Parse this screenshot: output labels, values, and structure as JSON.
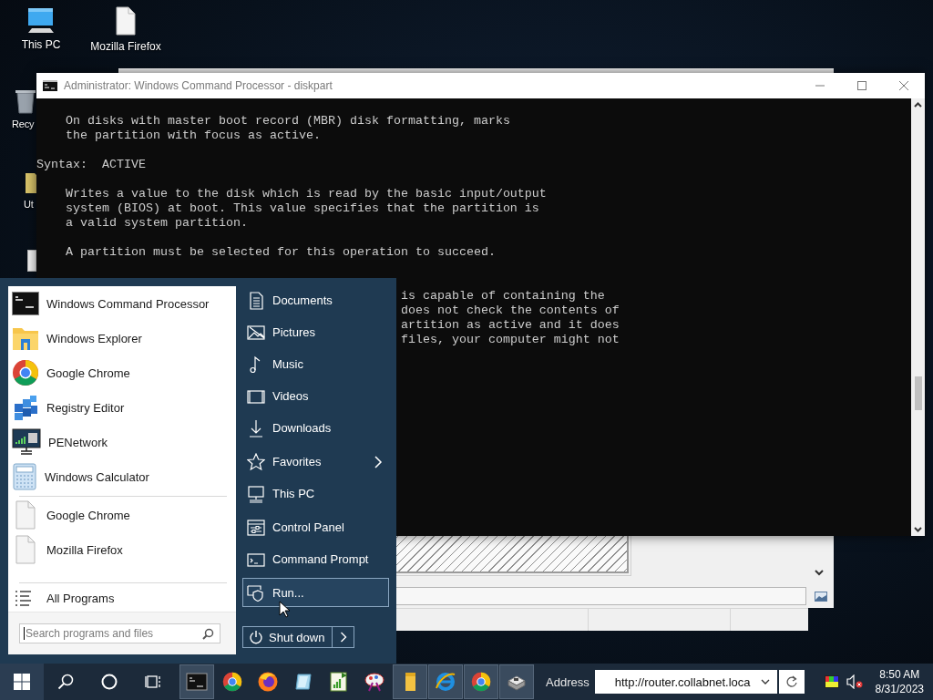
{
  "desktop_icons": [
    {
      "label": "This PC",
      "kind": "full"
    },
    {
      "label": "Mozilla Firefox",
      "kind": "full"
    },
    {
      "label": "Recy",
      "kind": "partial"
    },
    {
      "label": "Ut",
      "kind": "partial"
    }
  ],
  "console_window": {
    "title": "Administrator: Windows Command Processor - diskpart",
    "blocks": [
      {
        "kind": "indented",
        "lines": [
          "On disks with master boot record (MBR) disk formatting, marks",
          "the partition with focus as active."
        ]
      },
      {
        "kind": "flush",
        "lines": [
          "Syntax:  ACTIVE"
        ]
      },
      {
        "kind": "indented",
        "lines": [
          "Writes a value to the disk which is read by the basic input/output",
          "system (BIOS) at boot. This value specifies that the partition is",
          "a valid system partition."
        ]
      },
      {
        "kind": "indented",
        "lines": [
          "A partition must be selected for this operation to succeed."
        ]
      },
      {
        "kind": "covered",
        "lines": [
          "is capable of containing the",
          "does not check the contents of",
          "artition as active and it does",
          "files, your computer might not"
        ]
      }
    ]
  },
  "start_menu": {
    "programs": [
      {
        "label": "Windows Command Processor"
      },
      {
        "label": "Windows Explorer"
      },
      {
        "label": "Google Chrome"
      },
      {
        "label": "Registry Editor"
      },
      {
        "label": "PENetwork"
      },
      {
        "label": "Windows Calculator"
      }
    ],
    "recent": [
      {
        "label": "Google Chrome"
      },
      {
        "label": "Mozilla Firefox"
      }
    ],
    "all_programs": "All Programs",
    "search": {
      "placeholder": "Search programs and files"
    },
    "place_groups": [
      {
        "items": [
          {
            "label": "Documents",
            "selected": false,
            "submenu": false
          },
          {
            "label": "Pictures",
            "selected": false,
            "submenu": false
          },
          {
            "label": "Music",
            "selected": false,
            "submenu": false
          },
          {
            "label": "Videos",
            "selected": false,
            "submenu": false
          },
          {
            "label": "Downloads",
            "selected": false,
            "submenu": false
          }
        ]
      },
      {
        "items": [
          {
            "label": "Favorites",
            "selected": false,
            "submenu": true
          },
          {
            "label": "This PC",
            "selected": false,
            "submenu": false
          }
        ]
      },
      {
        "items": [
          {
            "label": "Control Panel",
            "selected": false,
            "submenu": false
          },
          {
            "label": "Command Prompt",
            "selected": false,
            "submenu": false
          }
        ]
      },
      {
        "items": [
          {
            "label": "Run...",
            "selected": true,
            "submenu": false
          }
        ]
      }
    ],
    "shutdown": "Shut down"
  },
  "taskbar": {
    "apps": [
      {
        "running": true
      },
      {
        "running": false
      },
      {
        "running": false
      },
      {
        "running": false
      },
      {
        "running": false
      },
      {
        "running": false
      },
      {
        "running": true
      },
      {
        "running": true
      },
      {
        "running": true
      },
      {
        "running": true
      }
    ],
    "address": {
      "label": "Address",
      "value": "http://router.collabnet.loca"
    },
    "clock": {
      "time": "8:50 AM",
      "date": "8/31/2023"
    }
  }
}
